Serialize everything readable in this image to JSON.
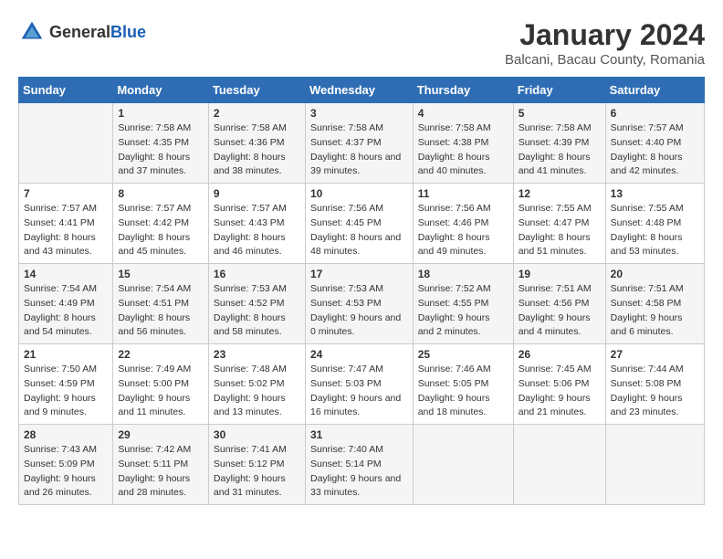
{
  "header": {
    "logo_general": "General",
    "logo_blue": "Blue",
    "title": "January 2024",
    "subtitle": "Balcani, Bacau County, Romania"
  },
  "calendar": {
    "days_of_week": [
      "Sunday",
      "Monday",
      "Tuesday",
      "Wednesday",
      "Thursday",
      "Friday",
      "Saturday"
    ],
    "weeks": [
      [
        {
          "day": "",
          "sunrise": "",
          "sunset": "",
          "daylight": ""
        },
        {
          "day": "1",
          "sunrise": "Sunrise: 7:58 AM",
          "sunset": "Sunset: 4:35 PM",
          "daylight": "Daylight: 8 hours and 37 minutes."
        },
        {
          "day": "2",
          "sunrise": "Sunrise: 7:58 AM",
          "sunset": "Sunset: 4:36 PM",
          "daylight": "Daylight: 8 hours and 38 minutes."
        },
        {
          "day": "3",
          "sunrise": "Sunrise: 7:58 AM",
          "sunset": "Sunset: 4:37 PM",
          "daylight": "Daylight: 8 hours and 39 minutes."
        },
        {
          "day": "4",
          "sunrise": "Sunrise: 7:58 AM",
          "sunset": "Sunset: 4:38 PM",
          "daylight": "Daylight: 8 hours and 40 minutes."
        },
        {
          "day": "5",
          "sunrise": "Sunrise: 7:58 AM",
          "sunset": "Sunset: 4:39 PM",
          "daylight": "Daylight: 8 hours and 41 minutes."
        },
        {
          "day": "6",
          "sunrise": "Sunrise: 7:57 AM",
          "sunset": "Sunset: 4:40 PM",
          "daylight": "Daylight: 8 hours and 42 minutes."
        }
      ],
      [
        {
          "day": "7",
          "sunrise": "Sunrise: 7:57 AM",
          "sunset": "Sunset: 4:41 PM",
          "daylight": "Daylight: 8 hours and 43 minutes."
        },
        {
          "day": "8",
          "sunrise": "Sunrise: 7:57 AM",
          "sunset": "Sunset: 4:42 PM",
          "daylight": "Daylight: 8 hours and 45 minutes."
        },
        {
          "day": "9",
          "sunrise": "Sunrise: 7:57 AM",
          "sunset": "Sunset: 4:43 PM",
          "daylight": "Daylight: 8 hours and 46 minutes."
        },
        {
          "day": "10",
          "sunrise": "Sunrise: 7:56 AM",
          "sunset": "Sunset: 4:45 PM",
          "daylight": "Daylight: 8 hours and 48 minutes."
        },
        {
          "day": "11",
          "sunrise": "Sunrise: 7:56 AM",
          "sunset": "Sunset: 4:46 PM",
          "daylight": "Daylight: 8 hours and 49 minutes."
        },
        {
          "day": "12",
          "sunrise": "Sunrise: 7:55 AM",
          "sunset": "Sunset: 4:47 PM",
          "daylight": "Daylight: 8 hours and 51 minutes."
        },
        {
          "day": "13",
          "sunrise": "Sunrise: 7:55 AM",
          "sunset": "Sunset: 4:48 PM",
          "daylight": "Daylight: 8 hours and 53 minutes."
        }
      ],
      [
        {
          "day": "14",
          "sunrise": "Sunrise: 7:54 AM",
          "sunset": "Sunset: 4:49 PM",
          "daylight": "Daylight: 8 hours and 54 minutes."
        },
        {
          "day": "15",
          "sunrise": "Sunrise: 7:54 AM",
          "sunset": "Sunset: 4:51 PM",
          "daylight": "Daylight: 8 hours and 56 minutes."
        },
        {
          "day": "16",
          "sunrise": "Sunrise: 7:53 AM",
          "sunset": "Sunset: 4:52 PM",
          "daylight": "Daylight: 8 hours and 58 minutes."
        },
        {
          "day": "17",
          "sunrise": "Sunrise: 7:53 AM",
          "sunset": "Sunset: 4:53 PM",
          "daylight": "Daylight: 9 hours and 0 minutes."
        },
        {
          "day": "18",
          "sunrise": "Sunrise: 7:52 AM",
          "sunset": "Sunset: 4:55 PM",
          "daylight": "Daylight: 9 hours and 2 minutes."
        },
        {
          "day": "19",
          "sunrise": "Sunrise: 7:51 AM",
          "sunset": "Sunset: 4:56 PM",
          "daylight": "Daylight: 9 hours and 4 minutes."
        },
        {
          "day": "20",
          "sunrise": "Sunrise: 7:51 AM",
          "sunset": "Sunset: 4:58 PM",
          "daylight": "Daylight: 9 hours and 6 minutes."
        }
      ],
      [
        {
          "day": "21",
          "sunrise": "Sunrise: 7:50 AM",
          "sunset": "Sunset: 4:59 PM",
          "daylight": "Daylight: 9 hours and 9 minutes."
        },
        {
          "day": "22",
          "sunrise": "Sunrise: 7:49 AM",
          "sunset": "Sunset: 5:00 PM",
          "daylight": "Daylight: 9 hours and 11 minutes."
        },
        {
          "day": "23",
          "sunrise": "Sunrise: 7:48 AM",
          "sunset": "Sunset: 5:02 PM",
          "daylight": "Daylight: 9 hours and 13 minutes."
        },
        {
          "day": "24",
          "sunrise": "Sunrise: 7:47 AM",
          "sunset": "Sunset: 5:03 PM",
          "daylight": "Daylight: 9 hours and 16 minutes."
        },
        {
          "day": "25",
          "sunrise": "Sunrise: 7:46 AM",
          "sunset": "Sunset: 5:05 PM",
          "daylight": "Daylight: 9 hours and 18 minutes."
        },
        {
          "day": "26",
          "sunrise": "Sunrise: 7:45 AM",
          "sunset": "Sunset: 5:06 PM",
          "daylight": "Daylight: 9 hours and 21 minutes."
        },
        {
          "day": "27",
          "sunrise": "Sunrise: 7:44 AM",
          "sunset": "Sunset: 5:08 PM",
          "daylight": "Daylight: 9 hours and 23 minutes."
        }
      ],
      [
        {
          "day": "28",
          "sunrise": "Sunrise: 7:43 AM",
          "sunset": "Sunset: 5:09 PM",
          "daylight": "Daylight: 9 hours and 26 minutes."
        },
        {
          "day": "29",
          "sunrise": "Sunrise: 7:42 AM",
          "sunset": "Sunset: 5:11 PM",
          "daylight": "Daylight: 9 hours and 28 minutes."
        },
        {
          "day": "30",
          "sunrise": "Sunrise: 7:41 AM",
          "sunset": "Sunset: 5:12 PM",
          "daylight": "Daylight: 9 hours and 31 minutes."
        },
        {
          "day": "31",
          "sunrise": "Sunrise: 7:40 AM",
          "sunset": "Sunset: 5:14 PM",
          "daylight": "Daylight: 9 hours and 33 minutes."
        },
        {
          "day": "",
          "sunrise": "",
          "sunset": "",
          "daylight": ""
        },
        {
          "day": "",
          "sunrise": "",
          "sunset": "",
          "daylight": ""
        },
        {
          "day": "",
          "sunrise": "",
          "sunset": "",
          "daylight": ""
        }
      ]
    ]
  }
}
